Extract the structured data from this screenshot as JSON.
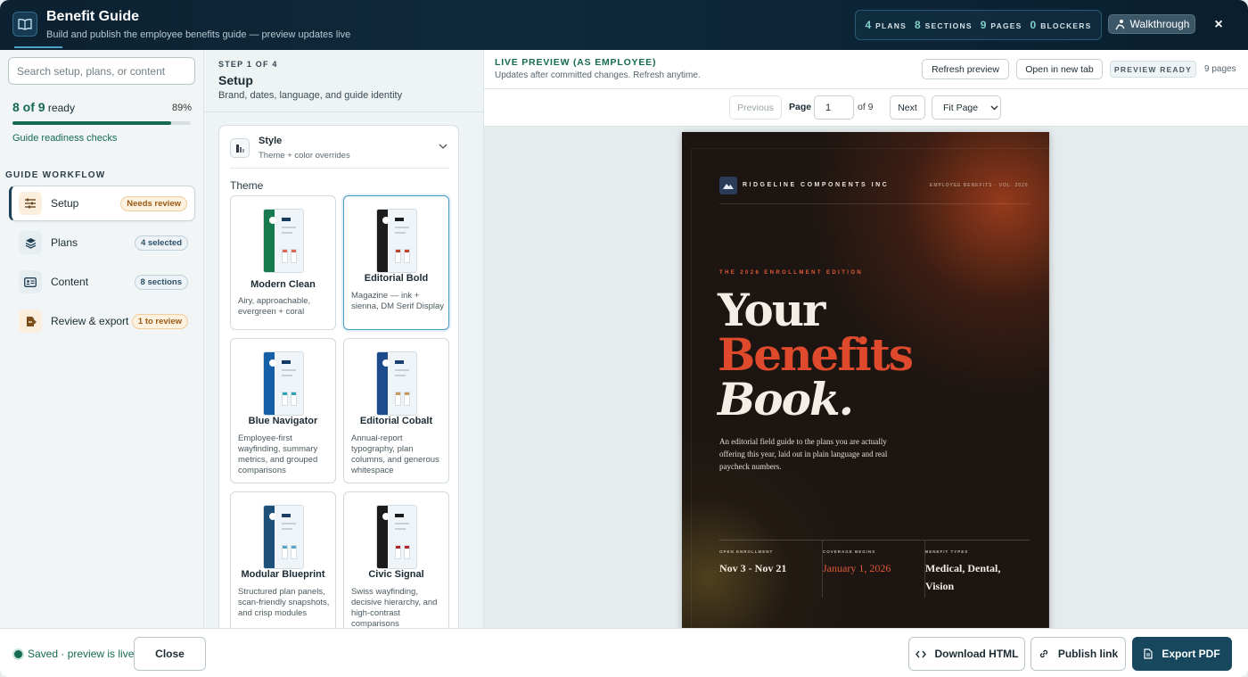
{
  "header": {
    "title": "Benefit Guide",
    "subtitle": "Build and publish the employee benefits guide — preview updates live",
    "stats": [
      {
        "num": "4",
        "label": "PLANS"
      },
      {
        "num": "8",
        "label": "SECTIONS"
      },
      {
        "num": "9",
        "label": "PAGES"
      },
      {
        "num": "0",
        "label": "BLOCKERS"
      }
    ],
    "walkthrough_label": "Walkthrough",
    "close_symbol": "×"
  },
  "sidebar": {
    "search_placeholder": "Search setup, plans, or content",
    "ready_count": "8 of 9",
    "ready_word": "ready",
    "ready_percent": "89%",
    "progress_fraction": 0.89,
    "readiness_link": "Guide readiness checks",
    "workflow_label": "GUIDE WORKFLOW",
    "items": [
      {
        "label": "Setup",
        "badge": "Needs review",
        "icon": "sliders-icon"
      },
      {
        "label": "Plans",
        "badge": "4 selected",
        "icon": "layers-icon"
      },
      {
        "label": "Content",
        "badge": "8 sections",
        "icon": "id-card-icon"
      },
      {
        "label": "Review & export",
        "badge": "1 to review",
        "icon": "export-icon"
      }
    ]
  },
  "setup": {
    "step_label": "STEP 1 OF 4",
    "title": "Setup",
    "subtitle": "Brand, dates, language, and guide identity",
    "style_title": "Style",
    "style_subtitle": "Theme + color overrides",
    "theme_label": "Theme",
    "themes": [
      {
        "name": "Modern Clean",
        "desc": "Airy, approachable, evergreen + coral",
        "side": "#167a4e",
        "bar": "#173b5c",
        "accent": "#e06a55"
      },
      {
        "name": "Editorial Bold",
        "desc": "Magazine — ink + sienna, DM Serif Display",
        "side": "#1d1d1d",
        "bar": "#1d1d1d",
        "accent": "#c2452d"
      },
      {
        "name": "Blue Navigator",
        "desc": "Employee-first wayfinding, summary metrics, and grouped comparisons",
        "side": "#145fa8",
        "bar": "#123a66",
        "accent": "#2fa5b8"
      },
      {
        "name": "Editorial Cobalt",
        "desc": "Annual-report typography, plan columns, and generous whitespace",
        "side": "#1d4a8c",
        "bar": "#1d3e72",
        "accent": "#c59a5a"
      },
      {
        "name": "Modular Blueprint",
        "desc": "Structured plan panels, scan-friendly snapshots, and crisp modules",
        "side": "#1d4f78",
        "bar": "#1d3f66",
        "accent": "#58a6c7"
      },
      {
        "name": "Civic Signal",
        "desc": "Swiss wayfinding, decisive hierarchy, and high-contrast comparisons",
        "side": "#1b1b1b",
        "bar": "#1b1b1b",
        "accent": "#b8232a"
      }
    ]
  },
  "preview": {
    "title": "LIVE PREVIEW (AS EMPLOYEE)",
    "subtitle": "Updates after committed changes. Refresh anytime.",
    "refresh_label": "Refresh preview",
    "open_tab_label": "Open in new tab",
    "status": "PREVIEW READY",
    "pages_label": "9 pages",
    "prev_label": "Previous",
    "page_label": "Page",
    "page_value": "1",
    "of_label": "of 9",
    "next_label": "Next",
    "fit_label": "Fit Page"
  },
  "document": {
    "company": "RIDGELINE COMPONENTS INC",
    "volume": "EMPLOYEE BENEFITS · VOL. 2026",
    "edition": "THE 2026 ENROLLMENT EDITION",
    "headline_1": "Your",
    "headline_2": "Benefits",
    "headline_3": "Book.",
    "intro": "An editorial field guide to the plans you are actually offering this year, laid out in plain language and real paycheck numbers.",
    "columns": [
      {
        "label": "OPEN ENROLLMENT",
        "value": "Nov 3 - Nov 21"
      },
      {
        "label": "COVERAGE BEGINS",
        "value": "January 1, 2026"
      },
      {
        "label": "BENEFIT TYPES",
        "value": "Medical, Dental, Vision"
      }
    ]
  },
  "footer": {
    "saved_label": "Saved · preview is live",
    "close_label": "Close",
    "download_label": "Download HTML",
    "publish_label": "Publish link",
    "export_label": "Export PDF"
  }
}
